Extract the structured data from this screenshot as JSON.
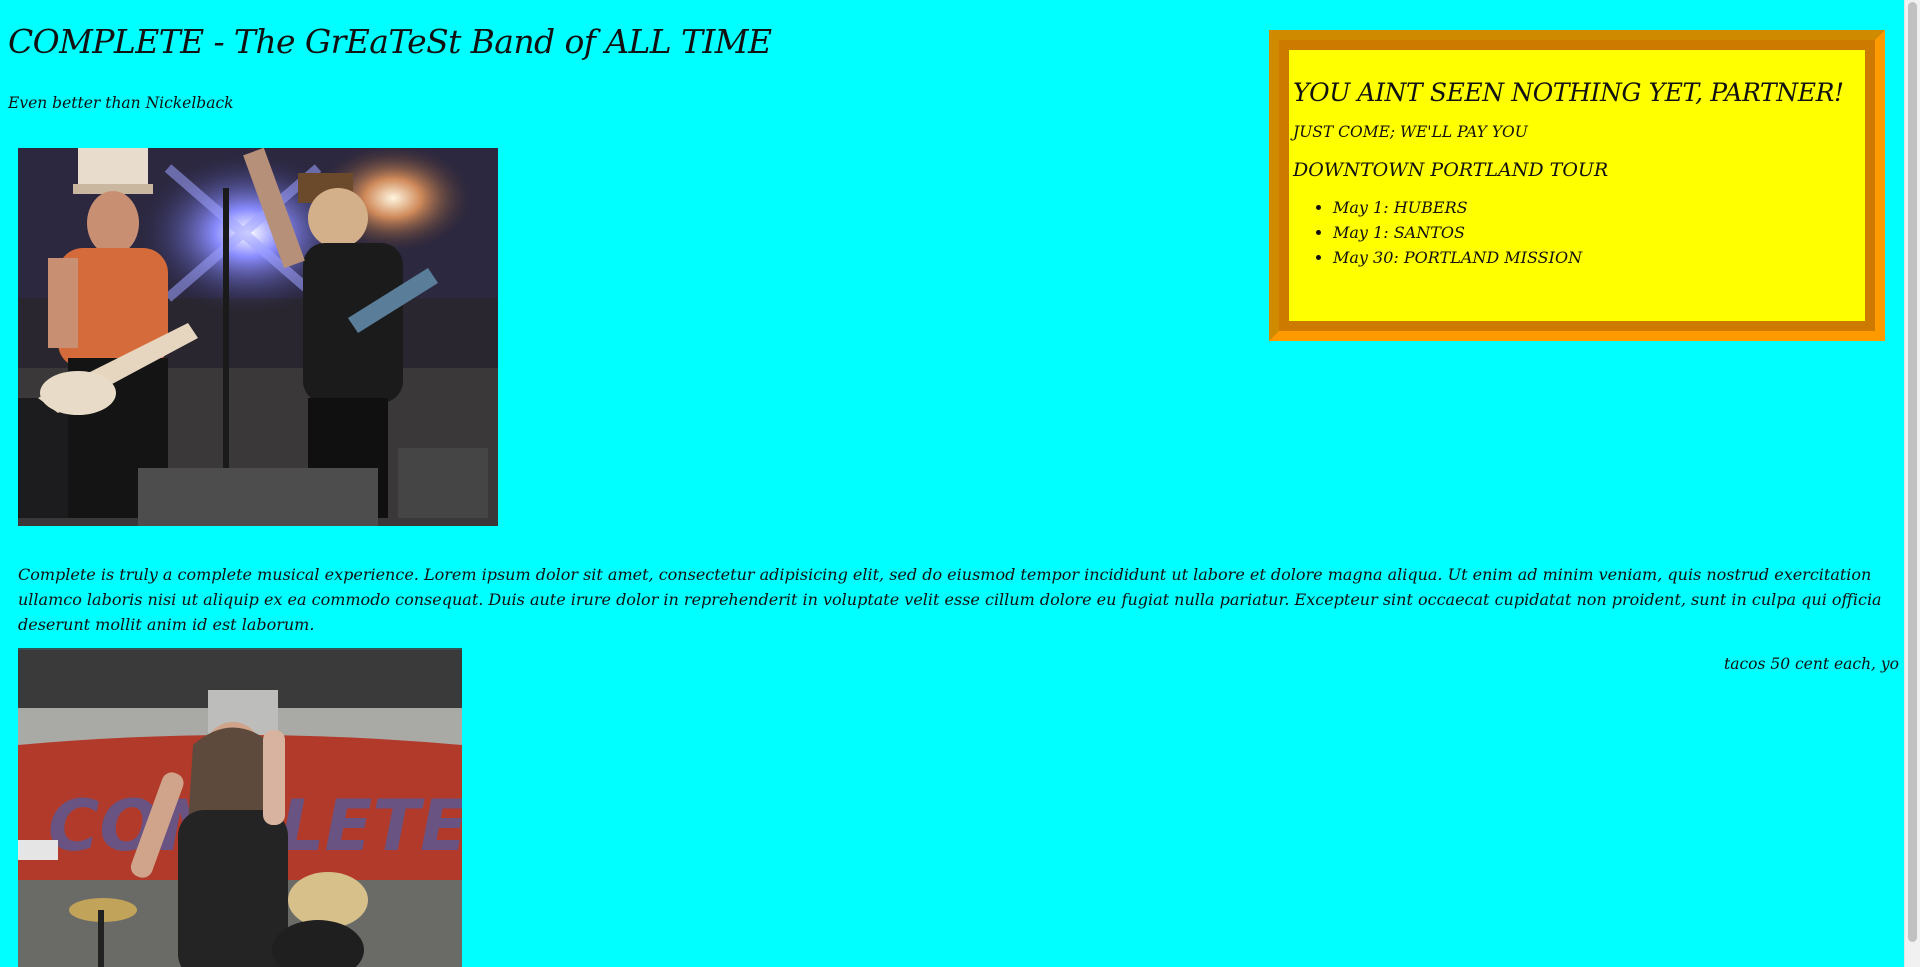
{
  "header": {
    "title": "COMPLETE - The GrEaTeSt Band of ALL TIME",
    "subtitle": "Even better than Nickelback"
  },
  "tour": {
    "heading": "YOU AINT SEEN NOTHING YET, PARTNER!",
    "tagline": "JUST COME; WE'LL PAY YOU",
    "name": "DOWNTOWN PORTLAND TOUR",
    "dates": [
      "May 1: HUBERS",
      "May 1: SANTOS",
      "May 30: PORTLAND MISSION"
    ]
  },
  "main": {
    "description": "Complete is truly a complete musical experience. Lorem ipsum dolor sit amet, consectetur adipisicing elit, sed do eiusmod tempor incididunt ut labore et dolore magna aliqua. Ut enim ad minim veniam, quis nostrud exercitation ullamco laboris nisi ut aliquip ex ea commodo consequat. Duis aute irure dolor in reprehenderit in voluptate velit esse cillum dolore eu fugiat nulla pariatur. Excepteur sint occaecat cupidatat non proident, sunt in culpa qui officia deserunt mollit anim id est laborum.",
    "side_note": "tacos 50 cent each, yo"
  },
  "colors": {
    "page_background": "#00ffff",
    "tour_background": "#ffff00",
    "tour_border": "#ff9900",
    "tour_border_shadow": "#cc7a00"
  },
  "images": [
    {
      "name": "band-photo-guitarists",
      "alt": ""
    },
    {
      "name": "band-photo-singer",
      "alt": ""
    }
  ]
}
